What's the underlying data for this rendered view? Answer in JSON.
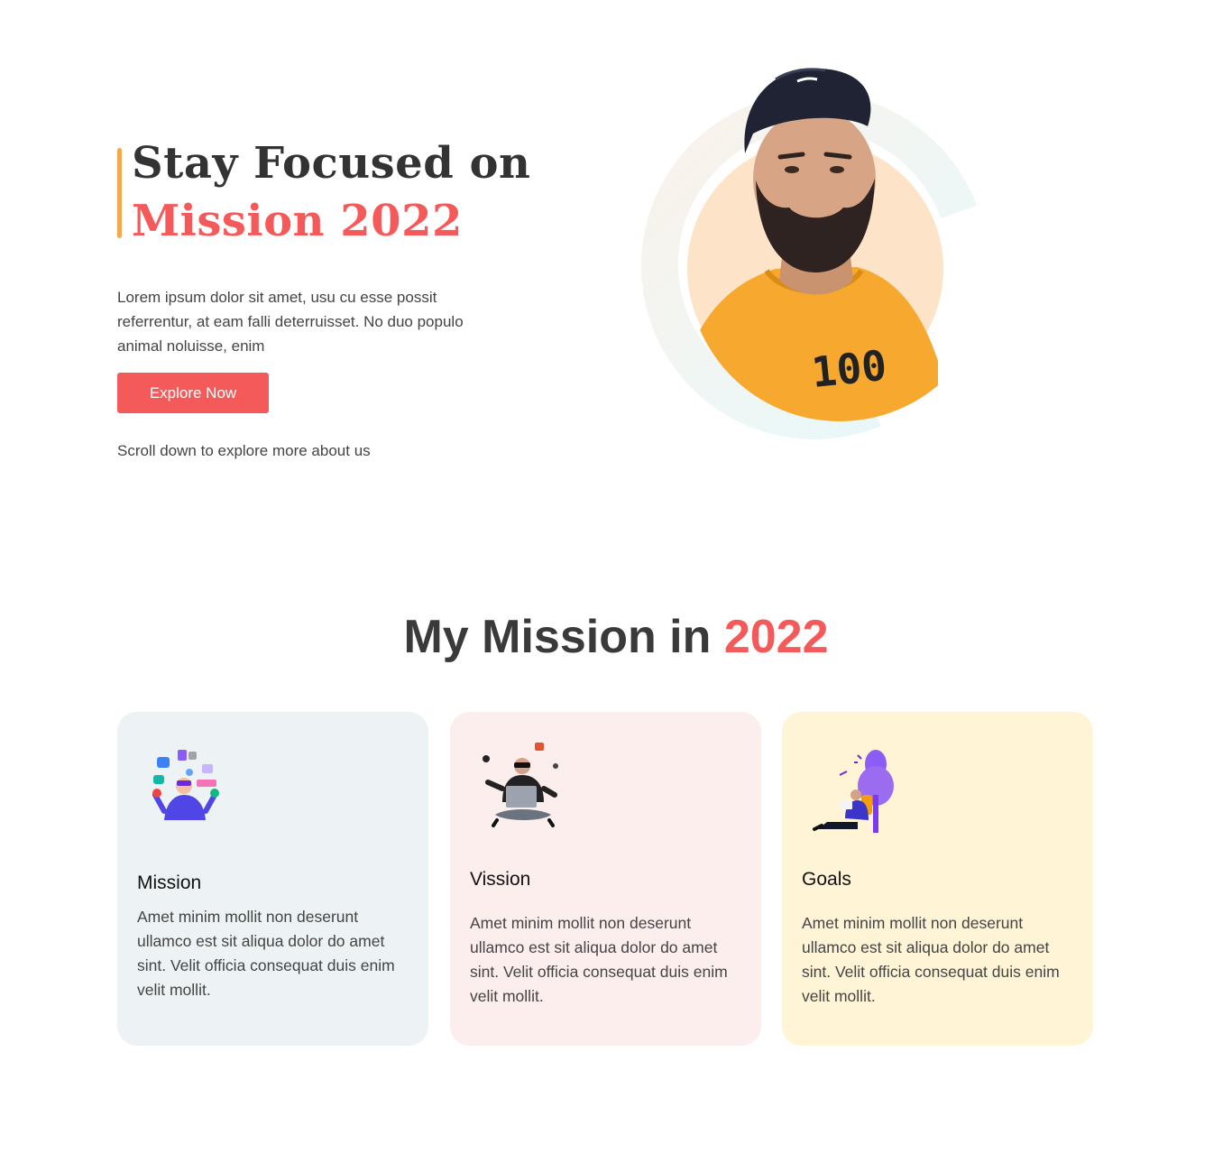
{
  "hero": {
    "title_line1": "Stay Focused on",
    "title_line2": "Mission 2022",
    "description": "Lorem ipsum dolor sit amet, usu cu esse possit referrentur, at eam falli deterruisset. No duo populo animal noluisse, enim",
    "cta_label": "Explore Now",
    "scroll_hint": "Scroll down to explore more about us",
    "portrait_shirt_text": "100"
  },
  "mission_section": {
    "title_prefix": "My Mission in ",
    "title_accent": "2022",
    "cards": [
      {
        "title": "Mission",
        "text": "Amet minim mollit non deserunt ullamco est sit aliqua dolor do amet sint. Velit officia consequat duis enim velit mollit.",
        "illustration": "juggling-apps-illustration"
      },
      {
        "title": "Vission",
        "text": "Amet minim mollit non deserunt ullamco est sit aliqua dolor do amet sint. Velit officia consequat duis enim velit mollit.",
        "illustration": "vr-laptop-illustration"
      },
      {
        "title": "Goals",
        "text": "Amet minim mollit non deserunt ullamco est sit aliqua dolor do amet sint. Velit officia consequat duis enim velit mollit.",
        "illustration": "reading-under-tree-illustration"
      }
    ]
  },
  "colors": {
    "accent_red": "#f55a5a",
    "accent_orange": "#f6a84f",
    "card1_bg": "#edf3f4",
    "card2_bg": "#fdeeee",
    "card3_bg": "#fff4d6"
  }
}
